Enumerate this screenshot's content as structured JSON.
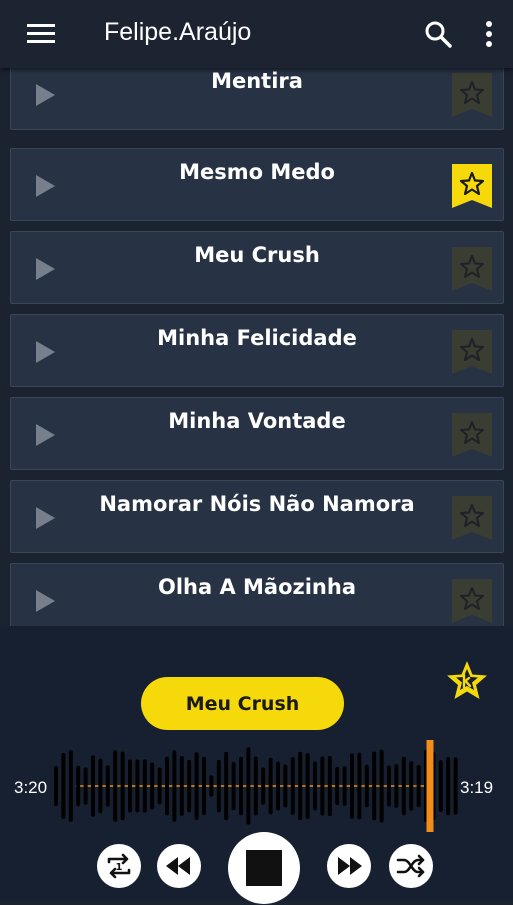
{
  "header": {
    "title": "Felipe.Araújo"
  },
  "songs": [
    {
      "title": "Mentira",
      "favorite": false
    },
    {
      "title": "Mesmo Medo",
      "favorite": true
    },
    {
      "title": "Meu Crush",
      "favorite": false
    },
    {
      "title": "Minha Felicidade",
      "favorite": false
    },
    {
      "title": "Minha Vontade",
      "favorite": false
    },
    {
      "title": "Namorar Nóis Não Namora",
      "favorite": false
    },
    {
      "title": "Olha A Mãozinha",
      "favorite": false
    }
  ],
  "player": {
    "now_playing": "Meu Crush",
    "elapsed": "3:20",
    "remaining": "3:19",
    "progress": 0.94
  },
  "colors": {
    "accent": "#f5d90a",
    "progress_marker": "#f28c1a",
    "card_bg": "#273244",
    "background": "#1b2230"
  }
}
